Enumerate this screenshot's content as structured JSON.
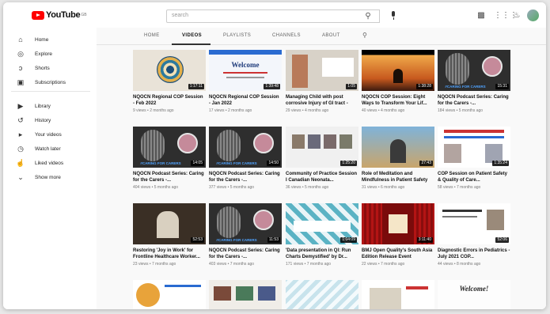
{
  "header": {
    "logo_text": "YouTube",
    "logo_sup": "GB",
    "search_placeholder": "search",
    "icons": [
      "search-icon",
      "mic-icon",
      "create-icon",
      "apps-icon",
      "bell-icon",
      "avatar"
    ]
  },
  "sidebar": {
    "items": [
      {
        "label": "Home",
        "icon": "home-icon",
        "glyph": "⌂"
      },
      {
        "label": "Explore",
        "icon": "explore-icon",
        "glyph": "◎"
      },
      {
        "label": "Shorts",
        "icon": "shorts-icon",
        "glyph": "ↄ"
      },
      {
        "label": "Subscriptions",
        "icon": "subscriptions-icon",
        "glyph": "▣"
      },
      {
        "label": "Library",
        "icon": "library-icon",
        "glyph": "▶"
      },
      {
        "label": "History",
        "icon": "history-icon",
        "glyph": "↺"
      },
      {
        "label": "Your videos",
        "icon": "your-videos-icon",
        "glyph": "▸"
      },
      {
        "label": "Watch later",
        "icon": "watch-later-icon",
        "glyph": "◷"
      },
      {
        "label": "Liked videos",
        "icon": "liked-videos-icon",
        "glyph": "👍"
      },
      {
        "label": "Show more",
        "icon": "chevron-down-icon",
        "glyph": "⌄"
      }
    ]
  },
  "tabs": [
    "HOME",
    "VIDEOS",
    "PLAYLISTS",
    "CHANNELS",
    "ABOUT"
  ],
  "active_tab": "VIDEOS",
  "videos": [
    {
      "title": "NQOCN Regional COP Session - Feb 2022",
      "meta": "9 views • 2 months ago",
      "duration": "1:17:11",
      "style": "mandala"
    },
    {
      "title": "NQOCN Regional COP Session - Jan 2022",
      "meta": "17 views • 2 months ago",
      "duration": "1:39:48",
      "style": "welcome"
    },
    {
      "title": "Managing Child with post corrosive Injury of GI tract -",
      "meta": "29 views • 4 months ago",
      "duration": "1:05",
      "style": "child"
    },
    {
      "title": "NQOCN COP Session: Eight Ways to Transform Your Lif...",
      "meta": "40 views • 4 months ago",
      "duration": "1:38:28",
      "style": "sunset"
    },
    {
      "title": "NQOCN Podcast Series: Caring for the Carers -...",
      "meta": "184 views • 5 months ago",
      "duration": "15:31",
      "style": "podcast"
    },
    {
      "title": "NQOCN Podcast Series: Caring for the Carers -...",
      "meta": "404 views • 5 months ago",
      "duration": "14:05",
      "style": "podcast"
    },
    {
      "title": "NQOCN Podcast Series: Caring for the Carers -...",
      "meta": "377 views • 5 months ago",
      "duration": "14:50",
      "style": "podcast"
    },
    {
      "title": "Community of Practice Session I Canadian Neonata...",
      "meta": "36 views • 5 months ago",
      "duration": "1:25:20",
      "style": "panel"
    },
    {
      "title": "Role of Meditation and Mindfulness in Patient Safety",
      "meta": "31 views • 6 months ago",
      "duration": "27:43",
      "style": "meditation"
    },
    {
      "title": "COP Session on Patient Safety & Quality of Care...",
      "meta": "58 views • 7 months ago",
      "duration": "1:35:24",
      "style": "flyer"
    },
    {
      "title": "Restoring 'Joy in Work' for Frontline Healthcare Worker...",
      "meta": "23 views • 7 months ago",
      "duration": "52:53",
      "style": "speaker"
    },
    {
      "title": "NQOCN Podcast Series: Caring for the Carers -...",
      "meta": "403 views • 7 months ago",
      "duration": "11:53",
      "style": "podcast"
    },
    {
      "title": "'Data presentation in QI: Run Charts Demystified' by Dr...",
      "meta": "171 views • 7 months ago",
      "duration": "1:04:09",
      "style": "pattern"
    },
    {
      "title": "BMJ Open Quality's South Asia Edition Release Event",
      "meta": "22 views • 7 months ago",
      "duration": "3:11:40",
      "style": "curtain"
    },
    {
      "title": "Diagnostic Errors in Pediatrics - July 2021 COP...",
      "meta": "44 views • 8 months ago",
      "duration": "52:06",
      "style": "slide"
    },
    {
      "title": "",
      "meta": "",
      "duration": "",
      "style": "flyer2"
    },
    {
      "title": "",
      "meta": "",
      "duration": "",
      "style": "collage"
    },
    {
      "title": "",
      "meta": "",
      "duration": "",
      "style": "lightpattern"
    },
    {
      "title": "",
      "meta": "",
      "duration": "",
      "style": "mapflyer"
    },
    {
      "title": "",
      "meta": "",
      "duration": "",
      "style": "welcome2"
    }
  ],
  "thumb_texts": {
    "welcome": "Welcome",
    "podcast": "#CARING FOR CARERS",
    "welcome2": "Welcome!"
  },
  "colors": {
    "brand_red": "#ff0000",
    "podcast_bg": "#2e2e2e",
    "accent_blue": "#2a6bd1"
  }
}
